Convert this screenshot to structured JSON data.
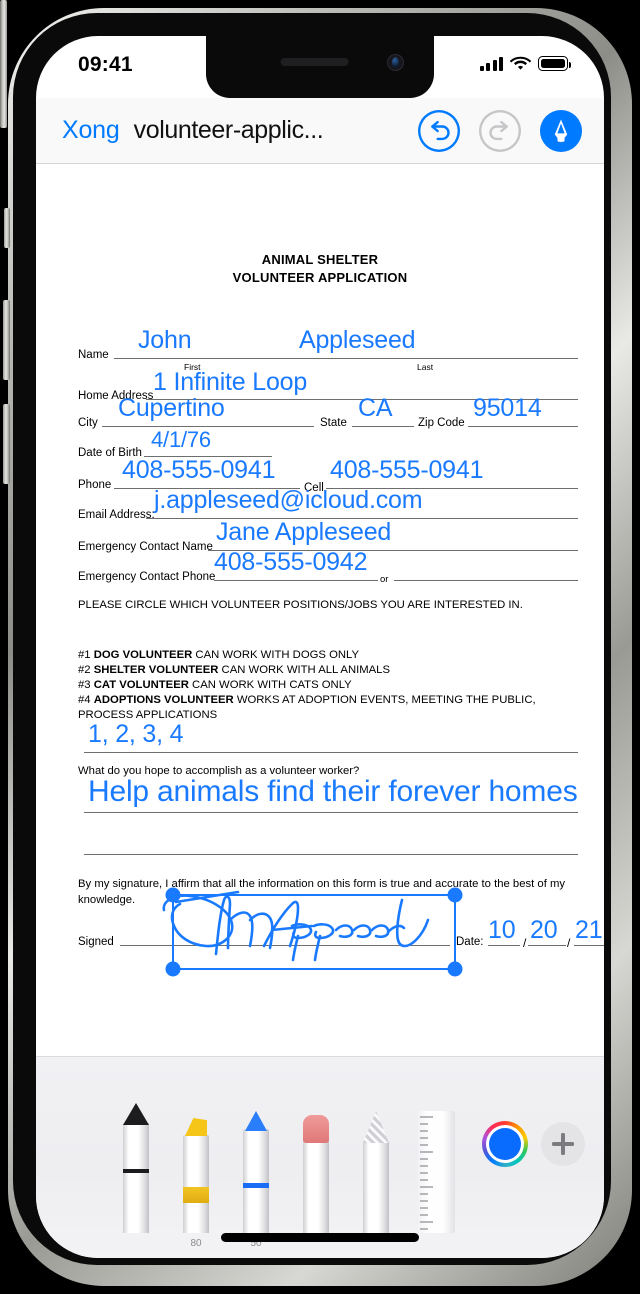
{
  "status_bar": {
    "time": "09:41",
    "cellular_icon": "signal-bars-icon",
    "wifi_icon": "wifi-icon",
    "battery_icon": "battery-full-icon"
  },
  "nav_bar": {
    "back_label": "Xong",
    "title": "volunteer-applic...",
    "undo_icon": "undo-icon",
    "redo_icon": "redo-icon",
    "markup_icon": "markup-pen-icon",
    "undo_enabled": "enabled",
    "redo_enabled": "disabled",
    "markup_active": "active"
  },
  "document": {
    "title_line1": "ANIMAL SHELTER",
    "title_line2": "VOLUNTEER APPLICATION",
    "fields": {
      "name_label": "Name",
      "name_first_value": "John",
      "name_last_value": "Appleseed",
      "name_first_caption": "First",
      "name_last_caption": "Last",
      "home_address_label": "Home Address",
      "home_address_value": "1 Infinite Loop",
      "city_label": "City",
      "city_value": "Cupertino",
      "state_label": "State",
      "state_value": "CA",
      "zip_label": "Zip Code",
      "zip_value": "95014",
      "dob_label": "Date of Birth",
      "dob_value": "4/1/76",
      "phone_label": "Phone",
      "phone_value": "408-555-0941",
      "cell_label": "Cell",
      "cell_value": "408-555-0941",
      "email_label": "Email Address:",
      "email_value": "j.appleseed@icloud.com",
      "emergency_name_label": "Emergency Contact Name",
      "emergency_name_value": "Jane Appleseed",
      "emergency_phone_label": "Emergency Contact Phone",
      "emergency_phone_value": "408-555-0942",
      "emergency_phone_or": "or",
      "emergency_phone_alt_value": ""
    },
    "instructions": "PLEASE CIRCLE WHICH VOLUNTEER POSITIONS/JOBS YOU ARE INTERESTED IN.",
    "positions": [
      {
        "number": "#1",
        "role": "DOG VOLUNTEER",
        "desc": " CAN WORK WITH DOGS ONLY"
      },
      {
        "number": "#2",
        "role": "SHELTER VOLUNTEER",
        "desc": " CAN WORK WITH ALL ANIMALS"
      },
      {
        "number": "#3",
        "role": "CAT VOLUNTEER",
        "desc": " CAN WORK WITH CATS ONLY"
      },
      {
        "number": "#4",
        "role": "ADOPTIONS VOLUNTEER",
        "desc": " WORKS AT ADOPTION EVENTS, MEETING THE PUBLIC, PROCESS APPLICATIONS"
      }
    ],
    "positions_answer": "1, 2, 3, 4",
    "goal_question": "What do you hope to accomplish as a volunteer worker?",
    "goal_answer": "Help animals find their forever homes",
    "goal_answer_line2": "",
    "affirmation": "By my signature, I affirm that all the information on this form is true and accurate to the best of my knowledge.",
    "signed_label": "Signed",
    "signature_value": "John Appleseed",
    "date_label": "Date:",
    "date_month": "10",
    "date_day": "20",
    "date_year": "21",
    "date_sep": "/",
    "selection": {
      "state": "signature-selected",
      "handle_icon": "resize-handle-icon"
    }
  },
  "markup_toolbar": {
    "tools": [
      {
        "name": "pen-tool",
        "tip_color": "#1c1c1e",
        "band_color": "#1c1c1e",
        "size_label": "",
        "selected": "false"
      },
      {
        "name": "highlighter-tool",
        "tip_color": "#f5c518",
        "band_color": "#f0c020",
        "size_label": "80",
        "selected": "false"
      },
      {
        "name": "marker-pen-tool",
        "tip_color": "#2a7dfb",
        "band_color": "#1a6ef5",
        "size_label": "50",
        "selected": "true"
      },
      {
        "name": "eraser-tool",
        "tip_color": "#e98b8b",
        "band_color": "",
        "size_label": "",
        "selected": "false"
      },
      {
        "name": "lasso-select-tool",
        "tip_color": "#c9c9cd",
        "band_color": "",
        "size_label": "",
        "selected": "false"
      },
      {
        "name": "ruler-tool",
        "tip_color": "#d8d8dc",
        "band_color": "",
        "size_label": "",
        "selected": "false"
      }
    ],
    "color_well": {
      "name": "color-picker",
      "current_color": "#0a6cff"
    },
    "add_button": {
      "name": "add-tool-button",
      "label": "+"
    }
  },
  "theme": {
    "accent_blue": "#007aff",
    "ink_blue": "#1a7aff",
    "toolbar_bg": "#f1f1f4",
    "nav_bg": "#f9f9f9",
    "page_bg": "#ffffff",
    "rule_gray": "#6e6e6e"
  }
}
